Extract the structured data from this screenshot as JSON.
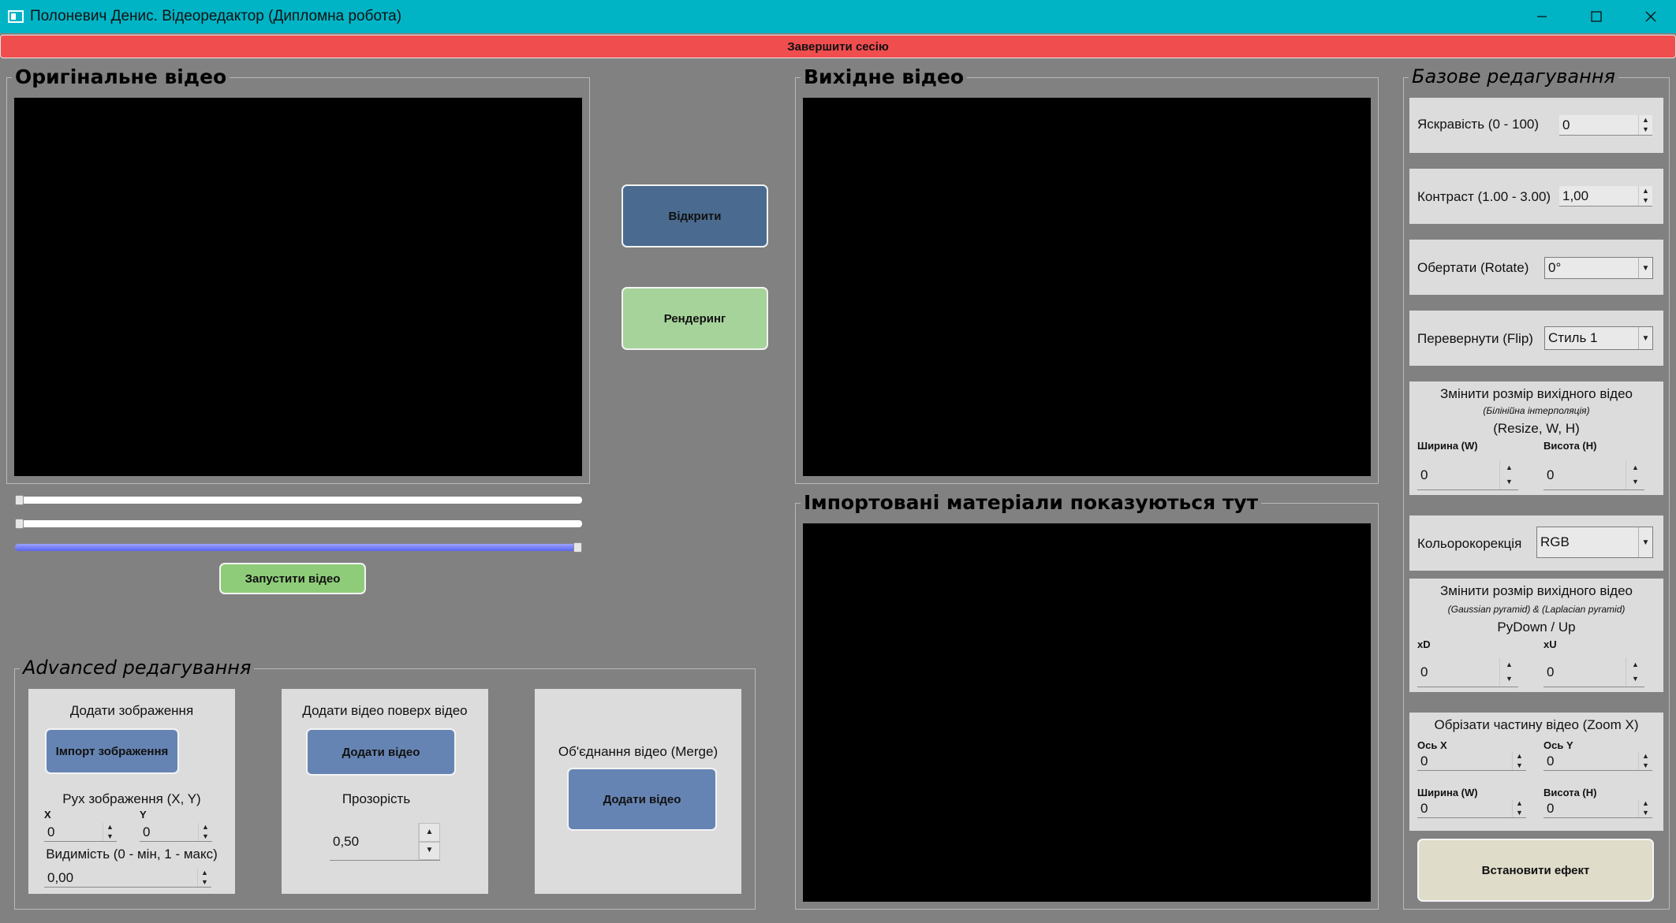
{
  "window": {
    "title": "Полоневич Денис. Відеоредактор (Дипломна робота)",
    "minimize_icon": "minimize-icon",
    "maximize_icon": "maximize-icon",
    "close_icon": "close-icon",
    "accent": "#00b4c6"
  },
  "session": {
    "end_label": "Завершити сесію",
    "color": "#f04d4f"
  },
  "original": {
    "title": "Оригінальне відео",
    "slider1_value": 0,
    "slider2_value": 0,
    "progress_value": 1.0,
    "play_label": "Запустити відео"
  },
  "actions": {
    "open_label": "Відкрити",
    "render_label": "Рендеринг"
  },
  "output": {
    "title": "Вихідне відео"
  },
  "imported": {
    "title": "Імпортовані матеріали показуються тут"
  },
  "advanced": {
    "title": "Advanced редагування",
    "image": {
      "heading": "Додати зображення",
      "import_label": "Імпорт зображення",
      "move_label": "Рух зображення (X, Y)",
      "x_label": "X",
      "y_label": "Y",
      "x_value": "0",
      "y_value": "0",
      "visibility_label": "Видимість (0 - мін, 1 - макс)",
      "visibility_value": "0,00"
    },
    "overlay": {
      "heading": "Додати відео поверх відео",
      "add_label": "Додати відео",
      "opacity_label": "Прозорість",
      "opacity_value": "0,50"
    },
    "merge": {
      "heading": "Об'єднання відео (Merge)",
      "add_label": "Додати відео"
    }
  },
  "basic": {
    "title": "Базове редагування",
    "brightness": {
      "label": "Яскравість (0 - 100)",
      "value": "0"
    },
    "contrast": {
      "label": "Контраст (1.00 - 3.00)",
      "value": "1,00"
    },
    "rotate": {
      "label": "Обертати (Rotate)",
      "value": "0°"
    },
    "flip": {
      "label": "Перевернути (Flip)",
      "value": "Стиль 1"
    },
    "resize": {
      "heading": "Змінити розмір вихідного відео",
      "subheading": "(Білінійна інтерполяція)",
      "caption": "(Resize, W, H)",
      "w_label": "Ширина (W)",
      "h_label": "Висота (H)",
      "w_value": "0",
      "h_value": "0"
    },
    "color": {
      "label": "Кольорокорекція",
      "value": "RGB"
    },
    "pyramid": {
      "heading": "Змінити розмір вихідного відео",
      "subheading": "(Gaussian pyramid) & (Laplacian pyramid)",
      "caption": "PyDown / Up",
      "xd_label": "xD",
      "xu_label": "xU",
      "xd_value": "0",
      "xu_value": "0"
    },
    "zoom": {
      "heading": "Обрізати частину відео (Zoom X)",
      "x_label": "Ось X",
      "y_label": "Ось Y",
      "w_label": "Ширина (W)",
      "h_label": "Висота (H)",
      "x_value": "0",
      "y_value": "0",
      "w_value": "0",
      "h_value": "0"
    },
    "apply_label": "Встановити ефект"
  }
}
